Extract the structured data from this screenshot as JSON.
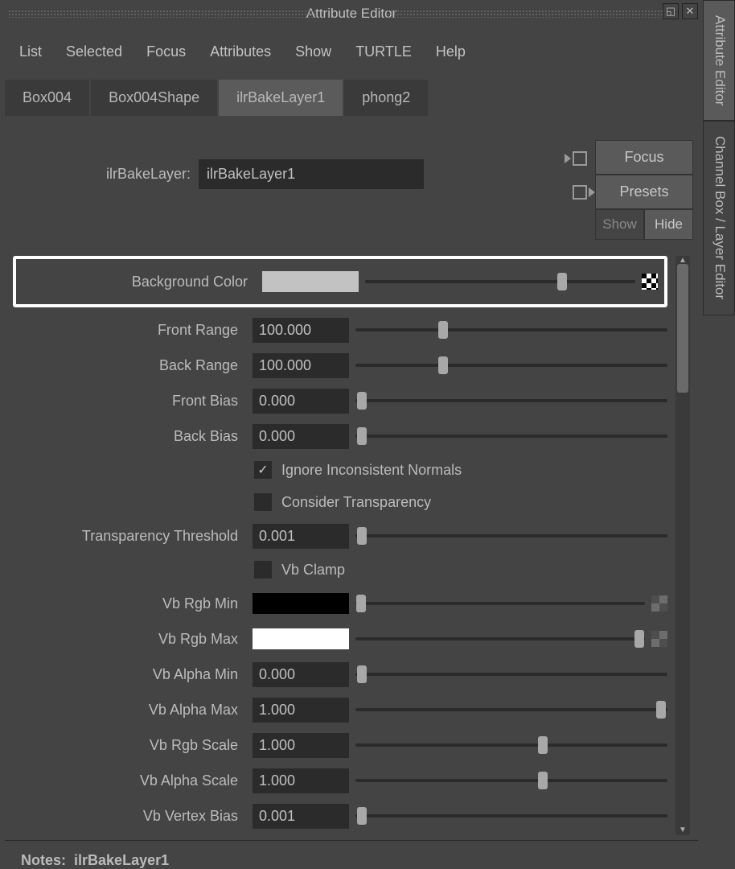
{
  "title": "Attribute Editor",
  "menubar": [
    "List",
    "Selected",
    "Focus",
    "Attributes",
    "Show",
    "TURTLE",
    "Help"
  ],
  "tabs": [
    {
      "label": "Box004",
      "active": false
    },
    {
      "label": "Box004Shape",
      "active": false
    },
    {
      "label": "ilrBakeLayer1",
      "active": true
    },
    {
      "label": "phong2",
      "active": false
    }
  ],
  "sidebar_tabs": [
    {
      "label": "Attribute Editor",
      "active": true
    },
    {
      "label": "Channel Box / Layer Editor",
      "active": false
    }
  ],
  "node_type_label": "ilrBakeLayer:",
  "node_name": "ilrBakeLayer1",
  "top_buttons": {
    "focus": "Focus",
    "presets": "Presets",
    "show": "Show",
    "hide": "Hide"
  },
  "attributes": {
    "background_color": {
      "label": "Background Color",
      "swatch": "#c2c2c2",
      "slider": 0.73
    },
    "front_range": {
      "label": "Front Range",
      "value": "100.000",
      "slider": 0.28
    },
    "back_range": {
      "label": "Back Range",
      "value": "100.000",
      "slider": 0.28
    },
    "front_bias": {
      "label": "Front Bias",
      "value": "0.000",
      "slider": 0.02
    },
    "back_bias": {
      "label": "Back Bias",
      "value": "0.000",
      "slider": 0.02
    },
    "ignore_inconsistent_normals": {
      "label": "Ignore Inconsistent Normals",
      "checked": true
    },
    "consider_transparency": {
      "label": "Consider Transparency",
      "checked": false
    },
    "transparency_threshold": {
      "label": "Transparency Threshold",
      "value": "0.001",
      "slider": 0.02
    },
    "vb_clamp": {
      "label": "Vb Clamp",
      "checked": false
    },
    "vb_rgb_min": {
      "label": "Vb Rgb Min",
      "swatch": "#000000",
      "slider": 0.02
    },
    "vb_rgb_max": {
      "label": "Vb Rgb Max",
      "swatch": "#ffffff",
      "slider": 0.98
    },
    "vb_alpha_min": {
      "label": "Vb Alpha Min",
      "value": "0.000",
      "slider": 0.02
    },
    "vb_alpha_max": {
      "label": "Vb Alpha Max",
      "value": "1.000",
      "slider": 0.98
    },
    "vb_rgb_scale": {
      "label": "Vb Rgb Scale",
      "value": "1.000",
      "slider": 0.6
    },
    "vb_alpha_scale": {
      "label": "Vb Alpha Scale",
      "value": "1.000",
      "slider": 0.6
    },
    "vb_vertex_bias": {
      "label": "Vb Vertex Bias",
      "value": "0.001",
      "slider": 0.02
    }
  },
  "notes_label": "Notes:",
  "notes_value": "ilrBakeLayer1"
}
